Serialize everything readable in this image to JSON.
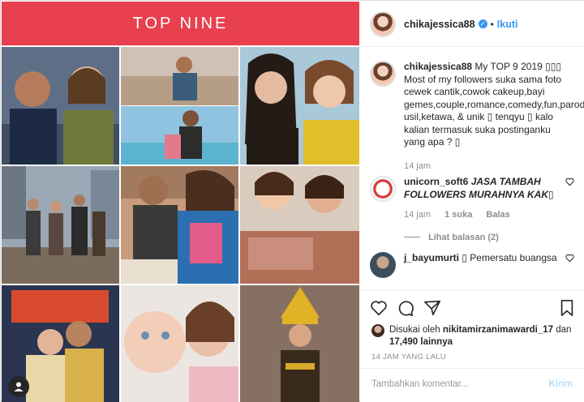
{
  "banner": {
    "title": "TOP NINE"
  },
  "post": {
    "username": "chikajessica88",
    "verified_mark": "•",
    "separator": "•",
    "follow_label": "Ikuti"
  },
  "caption": {
    "username": "chikajessica88",
    "text": "My TOP 9 2019 ▯▯▯ Most of my followers suka sama foto cewek cantik,cowok cakeup,bayi gemes,couple,romance,comedy,fun,parodi, usil,ketawa, & unik ▯ tenqyu ▯ kalo kalian termasuk suka postinganku yang apa ? ▯",
    "time": "14 jam"
  },
  "comments": [
    {
      "username": "unicorn_soft6",
      "text": "JASA TAMBAH FOLLOWERS MURAHNYA KAK▯",
      "time": "14 jam",
      "likes": "1 suka",
      "reply": "Balas",
      "view_replies": "Lihat balasan (2)"
    },
    {
      "username": "j_bayumurti",
      "text": "▯ Pemersatu buangsa"
    }
  ],
  "likes": {
    "prefix": "Disukai oleh",
    "user": "nikitamirzanimawardi_17",
    "join": "dan",
    "count": "17,490 lainnya"
  },
  "timestamp": "14 JAM YANG LALU",
  "comment_box": {
    "placeholder": "Tambahkan komentar...",
    "post_label": "Kirim"
  },
  "colors": {
    "banner": "#e8404f",
    "link": "#3897f0",
    "post_disabled": "#b2dffc"
  },
  "icons": [
    "heart-icon",
    "comment-icon",
    "share-icon",
    "bookmark-icon",
    "verified-badge-icon",
    "user-tag-icon"
  ]
}
